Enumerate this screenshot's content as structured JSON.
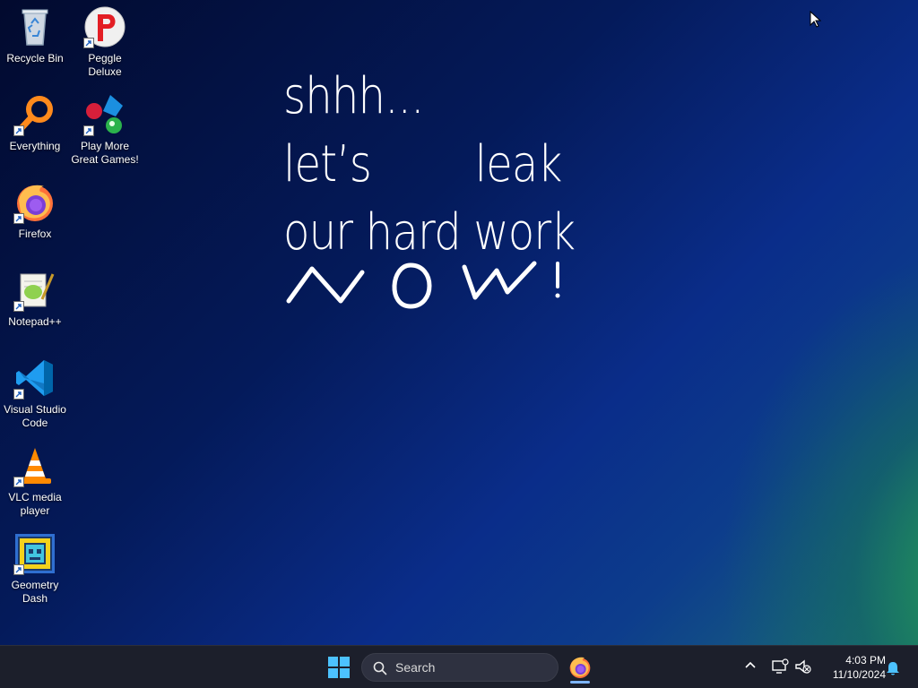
{
  "desktop": {
    "wallpaper_text": {
      "line1": "shhh...",
      "line2": "let’s        leak",
      "line3": "our hard work",
      "handwritten": "NOW!"
    },
    "icons": [
      {
        "label": "Recycle Bin",
        "icon": "recycle-bin-icon"
      },
      {
        "label": "Peggle Deluxe",
        "icon": "peggle-icon"
      },
      {
        "label": "Everything",
        "icon": "everything-search-icon"
      },
      {
        "label": "Play More Great Games!",
        "icon": "games-icon"
      },
      {
        "label": "Firefox",
        "icon": "firefox-icon"
      },
      {
        "label": "Notepad++",
        "icon": "notepadpp-icon"
      },
      {
        "label": "Visual Studio Code",
        "icon": "vscode-icon"
      },
      {
        "label": "VLC media player",
        "icon": "vlc-icon"
      },
      {
        "label": "Geometry Dash",
        "icon": "geometry-dash-icon"
      }
    ]
  },
  "taskbar": {
    "search_label": "Search",
    "pinned_app": "firefox-icon",
    "clock_time": "4:03 PM",
    "clock_date": "11/10/2024"
  },
  "colors": {
    "taskbar_bg": "#1c1f2b",
    "accent": "#7db4ff"
  }
}
